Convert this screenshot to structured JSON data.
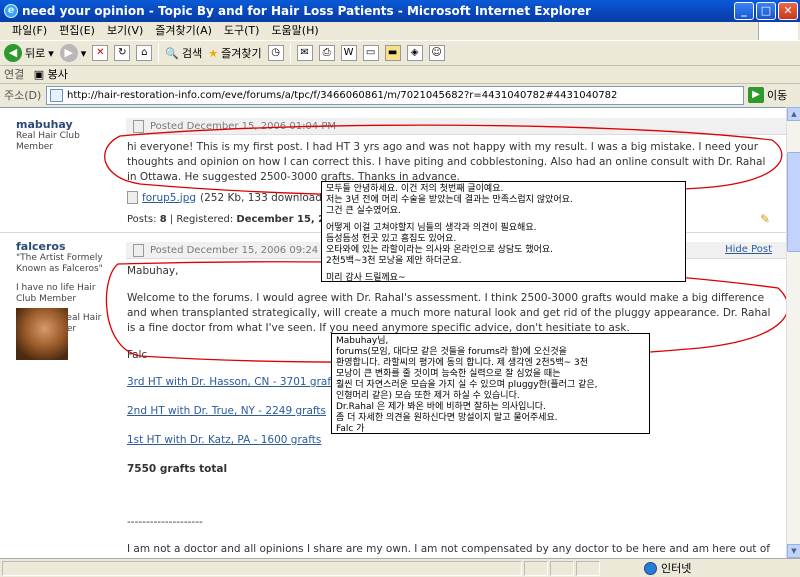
{
  "window": {
    "title": "need your opinion - Topic By and for Hair Loss Patients - Microsoft Internet Explorer",
    "controls": [
      "_",
      "□",
      "✕"
    ]
  },
  "menu": [
    "파일(F)",
    "편집(E)",
    "보기(V)",
    "즐겨찾기(A)",
    "도구(T)",
    "도움말(H)"
  ],
  "toolbar": {
    "back": "뒤로",
    "search": "검색",
    "favorites": "즐겨찾기"
  },
  "links_bar": {
    "label": "연결",
    "item": "봉사"
  },
  "address": {
    "label": "주소(D)",
    "url": "http://hair-restoration-info.com/eve/forums/a/tpc/f/3466060861/m/7021045682?r=4431040782#4431040782",
    "go": "이동"
  },
  "posts": [
    {
      "author": "mabuhay",
      "titles": [
        "Real Hair Club",
        "Member"
      ],
      "date": "Posted December 15, 2006 01:04 PM",
      "body": "hi everyone! This is my first post. I had HT 3 yrs ago and was not happy with my result. I was a big mistake. I need your thoughts and opinion on how I can correct this. I have piting and cobblestoning. Also had an online consult with Dr. Rahal in Ottawa. He suggested 2500-3000 grafts. Thanks in advance.",
      "attachment": "forup5.jpg",
      "attachment_meta": "(252 Kb, 133 downloads)",
      "posts_label": "Posts:",
      "posts_count": "8",
      "registered_label": "| Registered:",
      "registered": "December 15, 2006"
    },
    {
      "author": "falceros",
      "titles": [
        "\"The Artist Formely",
        "Known as Falceros\"",
        "",
        "I have no life Hair",
        "Club Member",
        "",
        "Honorary Real Hair",
        "Club Member"
      ],
      "date": "Posted December 15, 2006 09:24 PM",
      "hide": "Hide Post",
      "greeting": "Mabuhay,",
      "body": "Welcome to the forums. I would agree with Dr. Rahal's assessment. I think 2500-3000 grafts would make a big difference and when transplanted strategically, will create a much more natural look and get rid of the pluggy appearance. Dr. Rahal is a fine doctor from what I've seen. If you need anymore specific advice, don't hesitiate to ask.",
      "sign": "Falc",
      "sigs": [
        "3rd HT with Dr. Hasson, CN - 3701 grafts",
        "2nd HT with Dr. True, NY - 2249 grafts",
        "1st HT with Dr. Katz, PA - 1600 grafts"
      ],
      "total": "7550 grafts total",
      "dashes": "--------------------",
      "disclaimer": "I am not a doctor and all opinions I share are my own. I am not compensated by any doctor to be here and am here out of my own free will to offer helps, knowledge, and wisdom to anyone who requests it."
    }
  ],
  "notes": {
    "first": [
      "모두들 안녕하세요. 이건 저의 첫번째 글이예요.",
      "저는 3년 전에 머리 수술을 받았는데 결과는 만족스럽지 않았어요.",
      "그건 큰 실수였어요.",
      "",
      "어떻게 이걸 고쳐야할지 님들의 생각과 의견이 필요해요.",
      "듬성듬성 헌곳 있고 흠집도 있어요.",
      "오타와에 있는 라할이라는 의사와 온라인으로 상담도 했어요.",
      "2천5백~3천 모낭을 제안 하더군요.",
      "",
      "미리 감사 드릴께요~"
    ],
    "second": [
      "Mabuhay님,",
      "forums(모임, 대다모 같은 것들을 forums라 함)에 오신것을",
      "환영합니다. 라할씨의 평가에 동의 합니다. 제 생각엔 2천5백~ 3천",
      "모낭이 큰 변화를 줄 것이며 능숙한 실력으로 잘 심었을 때는",
      "훨씬 더 자연스러운 모습을 가지 실 수 있으며 pluggy한(플러그 같은,",
      "인형머리 같은) 모습 또한 제거 하실 수 있습니다.",
      "Dr.Rahal 은 제가 봐온 바에 비하면 잘하는 의사입니다.",
      "좀 더 자세한 의견을 원하신다면 망설이지 말고 물어주세요.",
      "Falc 가"
    ]
  },
  "status": {
    "zone": "인터넷"
  },
  "colors": {
    "titlebar": "#0a5bd8",
    "link": "#2a5aa0",
    "annotation": "#dd0000"
  }
}
